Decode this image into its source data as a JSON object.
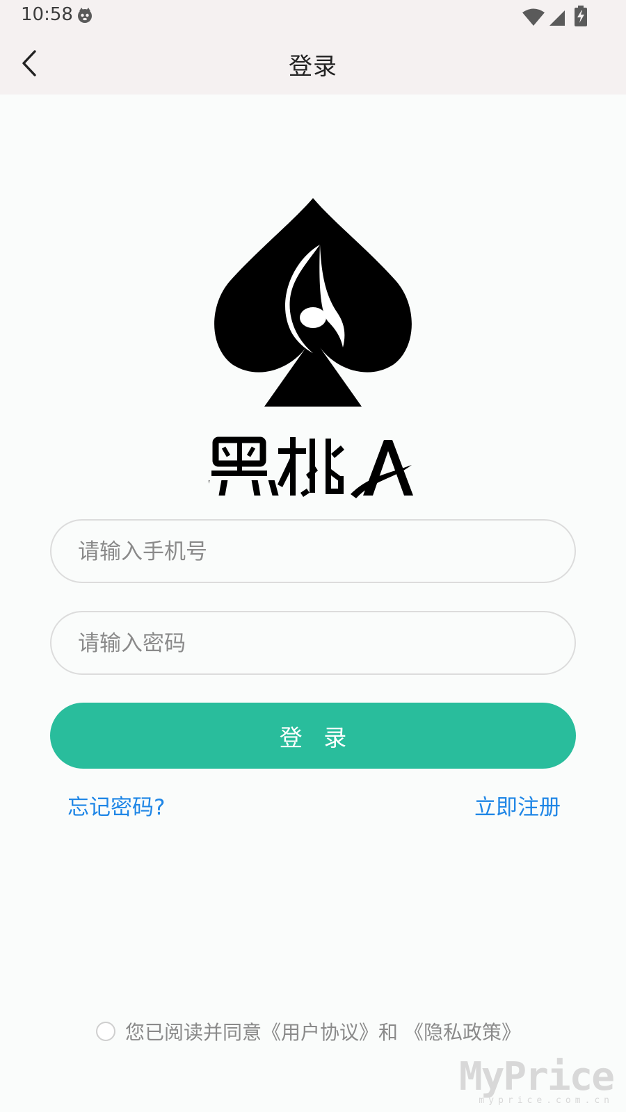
{
  "status_bar": {
    "time": "10:58",
    "icons": [
      "cat-notification-icon",
      "wifi-icon",
      "signal-icon",
      "battery-charging-icon"
    ]
  },
  "nav": {
    "title": "登录",
    "back_icon": "chevron-left-icon"
  },
  "logo": {
    "wordmark": "黑桃A",
    "emblem_icon": "spade-icon"
  },
  "form": {
    "phone_placeholder": "请输入手机号",
    "phone_value": "",
    "password_placeholder": "请输入密码",
    "password_value": "",
    "login_label": "登 录"
  },
  "links": {
    "forgot_password": "忘记密码?",
    "register": "立即注册"
  },
  "agreement": {
    "checked": false,
    "prefix": "您已阅读并同意",
    "user_agreement": "《用户协议》",
    "connector": "和 ",
    "privacy_policy": "《隐私政策》"
  },
  "watermark": {
    "main": "MyPrice",
    "sub": "myprice.com.cn"
  },
  "colors": {
    "accent": "#29bd9c",
    "link": "#1f86e6",
    "header_bg": "#f5f1f1",
    "page_bg": "#fafcfb"
  }
}
